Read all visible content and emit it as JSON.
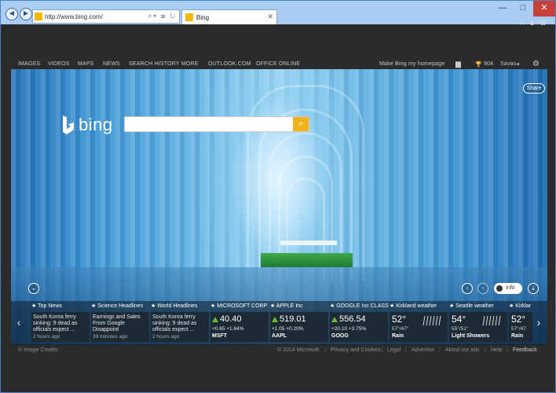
{
  "browser": {
    "address": "http://www.bing.com/",
    "tab_title": "Bing",
    "controls": {
      "minimize": "—",
      "maximize": "□",
      "close": "✕"
    }
  },
  "nav": {
    "items": [
      "IMAGES",
      "VIDEOS",
      "MAPS",
      "NEWS",
      "SEARCH HISTORY",
      "MORE",
      "OUTLOOK.COM",
      "OFFICE ONLINE"
    ],
    "make_homepage": "Make Bing my homepage",
    "rewards_count": "904",
    "user": "Savas"
  },
  "brand": {
    "logo_text": "bing"
  },
  "search": {
    "placeholder": "",
    "value": ""
  },
  "hero": {
    "share": "Share",
    "info": "Info"
  },
  "strip": {
    "cards": [
      {
        "kind": "news",
        "header": "★ Top News",
        "text": "South Korea ferry sinking: 9 dead as officials expect ...",
        "time": "2 hours ago"
      },
      {
        "kind": "news",
        "header": "★ Science Headlines",
        "text": "Earnings and Sales From Google Disappoint",
        "time": "39 minutes ago"
      },
      {
        "kind": "news",
        "header": "★ World Headlines",
        "text": "South Korea ferry sinking: 9 dead as officials expect ...",
        "time": "2 hours ago"
      },
      {
        "kind": "stock",
        "header": "★ MICROSOFT CORP",
        "price": "40.40",
        "change": "+0.65 +1.64%",
        "symbol": "MSFT"
      },
      {
        "kind": "stock",
        "header": "★ APPLE Inc",
        "price": "519.01",
        "change": "+1.05 +0.20%",
        "symbol": "AAPL"
      },
      {
        "kind": "stock",
        "header": "★ GOOGLE Inc CLASS C...",
        "price": "556.54",
        "change": "+20.10 +3.75%",
        "symbol": "GOOG"
      },
      {
        "kind": "weather",
        "header": "★ Kirkland weather",
        "temp": "52°",
        "hilo": "57°/47°",
        "cond": "Rain"
      },
      {
        "kind": "weather",
        "header": "★ Seattle weather",
        "temp": "54°",
        "hilo": "55°/51°",
        "cond": "Light Showers"
      },
      {
        "kind": "weather",
        "header": "★ Kirklar",
        "temp": "52°",
        "hilo": "57°/47",
        "cond": "Rain"
      }
    ]
  },
  "footer": {
    "image_credits": "© Image Credits",
    "copyright": "© 2014 Microsoft",
    "privacy": "Privacy and Cookies",
    "legal": "Legal",
    "advertise": "Advertise",
    "about_ads": "About our ads",
    "help": "Help",
    "feedback": "Feedback"
  },
  "colors": {
    "accent": "#f1b31c",
    "stock_up": "#6dbd2b"
  }
}
